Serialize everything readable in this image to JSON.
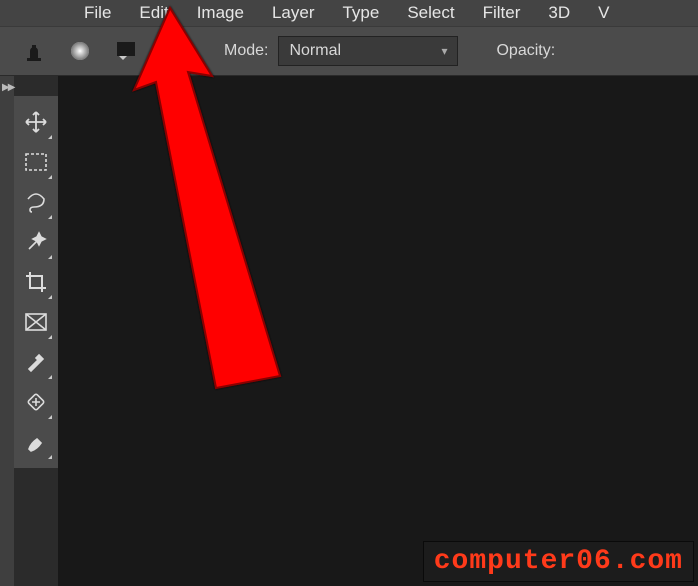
{
  "menubar": {
    "items": [
      "File",
      "Edit",
      "Image",
      "Layer",
      "Type",
      "Select",
      "Filter",
      "3D",
      "V"
    ]
  },
  "optionsbar": {
    "mode_label": "Mode:",
    "mode_value": "Normal",
    "opacity_label": "Opacity:"
  },
  "toolbar": {
    "tools": [
      "move-tool",
      "rectangular-marquee-tool",
      "lasso-tool",
      "magic-wand-tool",
      "crop-tool",
      "frame-tool",
      "eyedropper-tool",
      "healing-brush-tool",
      "brush-tool"
    ]
  },
  "watermark": "computer06.com"
}
